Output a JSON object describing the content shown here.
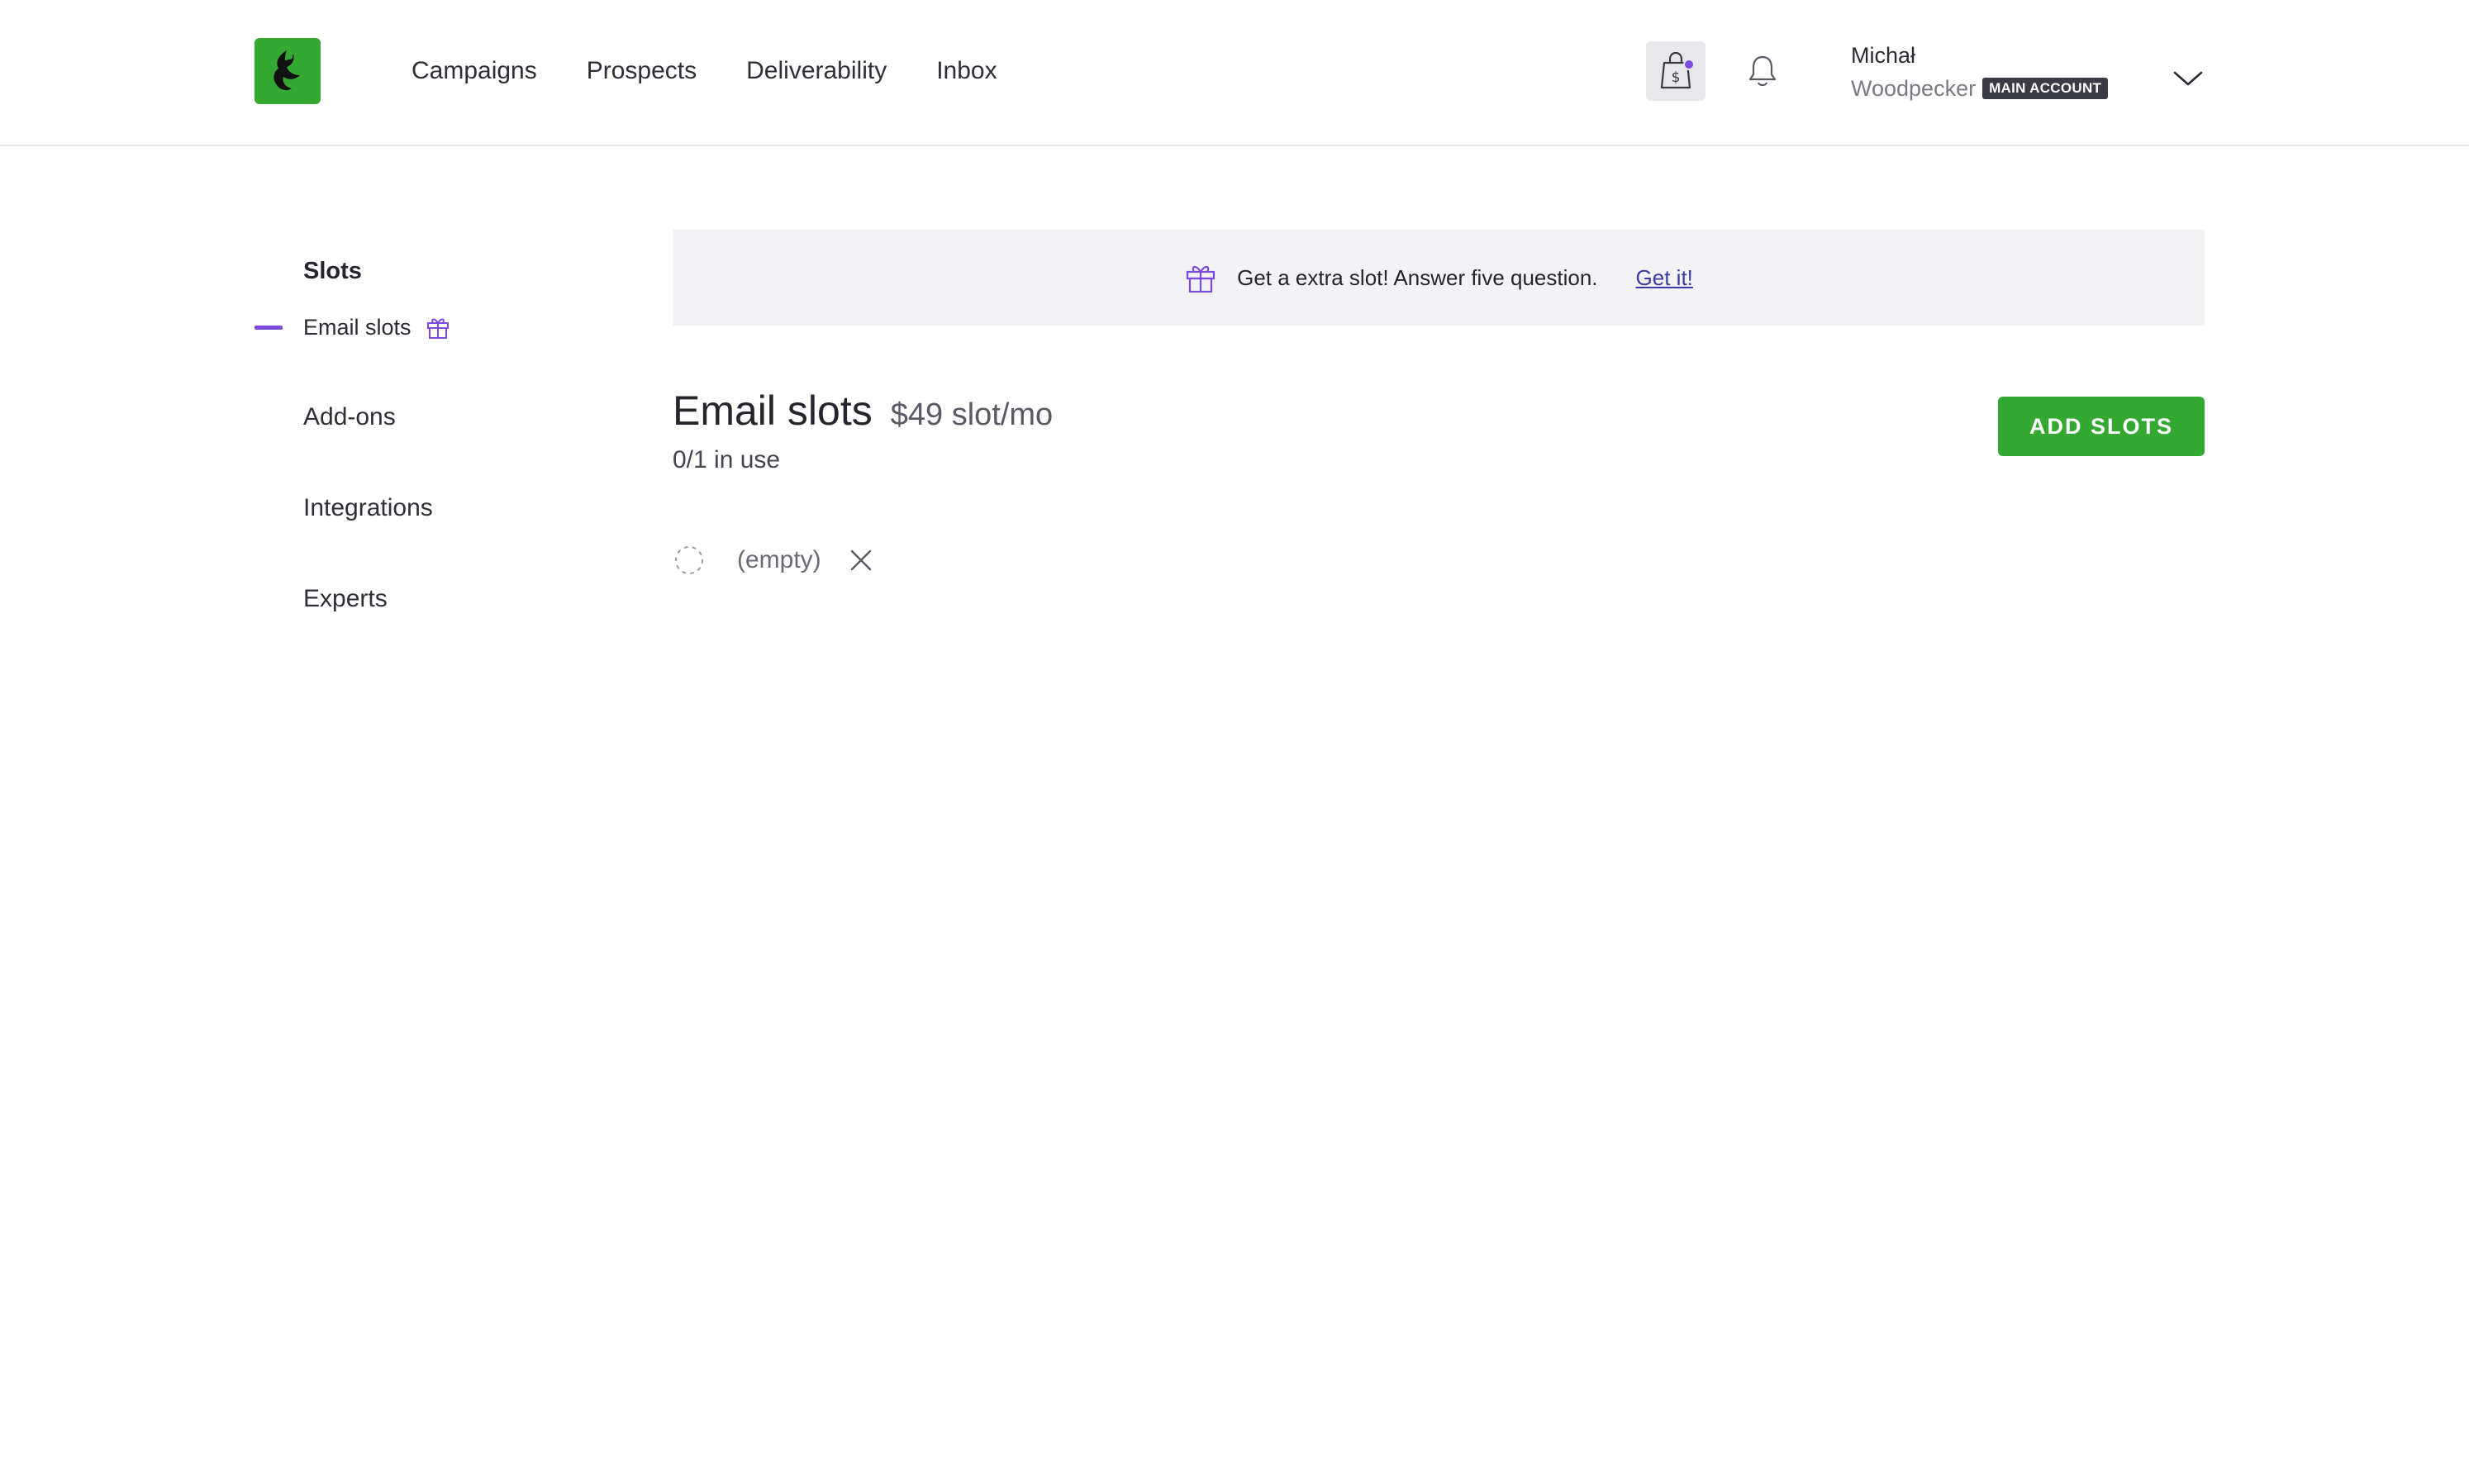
{
  "header": {
    "nav": [
      "Campaigns",
      "Prospects",
      "Deliverability",
      "Inbox"
    ],
    "user": {
      "first_name": "Michał",
      "last_name": "Woodpecker",
      "badge": "MAIN ACCOUNT"
    },
    "icons": {
      "logo": "woodpecker-logo",
      "shop": "shopping-bag-dollar-icon",
      "notifications": "bell-icon",
      "dropdown": "chevron-down-icon"
    }
  },
  "sidebar": {
    "heading": "Slots",
    "active_item": "Email slots",
    "items": [
      "Add-ons",
      "Integrations",
      "Experts"
    ]
  },
  "promo": {
    "text": "Get a extra slot! Answer five question.",
    "link": "Get it!"
  },
  "main": {
    "title": "Email slots",
    "price": "$49 slot/mo",
    "usage": "0/1 in use",
    "add_button": "ADD SLOTS",
    "slots": [
      {
        "label": "(empty)"
      }
    ]
  },
  "colors": {
    "brand_green": "#35a831",
    "accent_purple": "#7b4be0",
    "link_blue": "#3b3ba8"
  }
}
